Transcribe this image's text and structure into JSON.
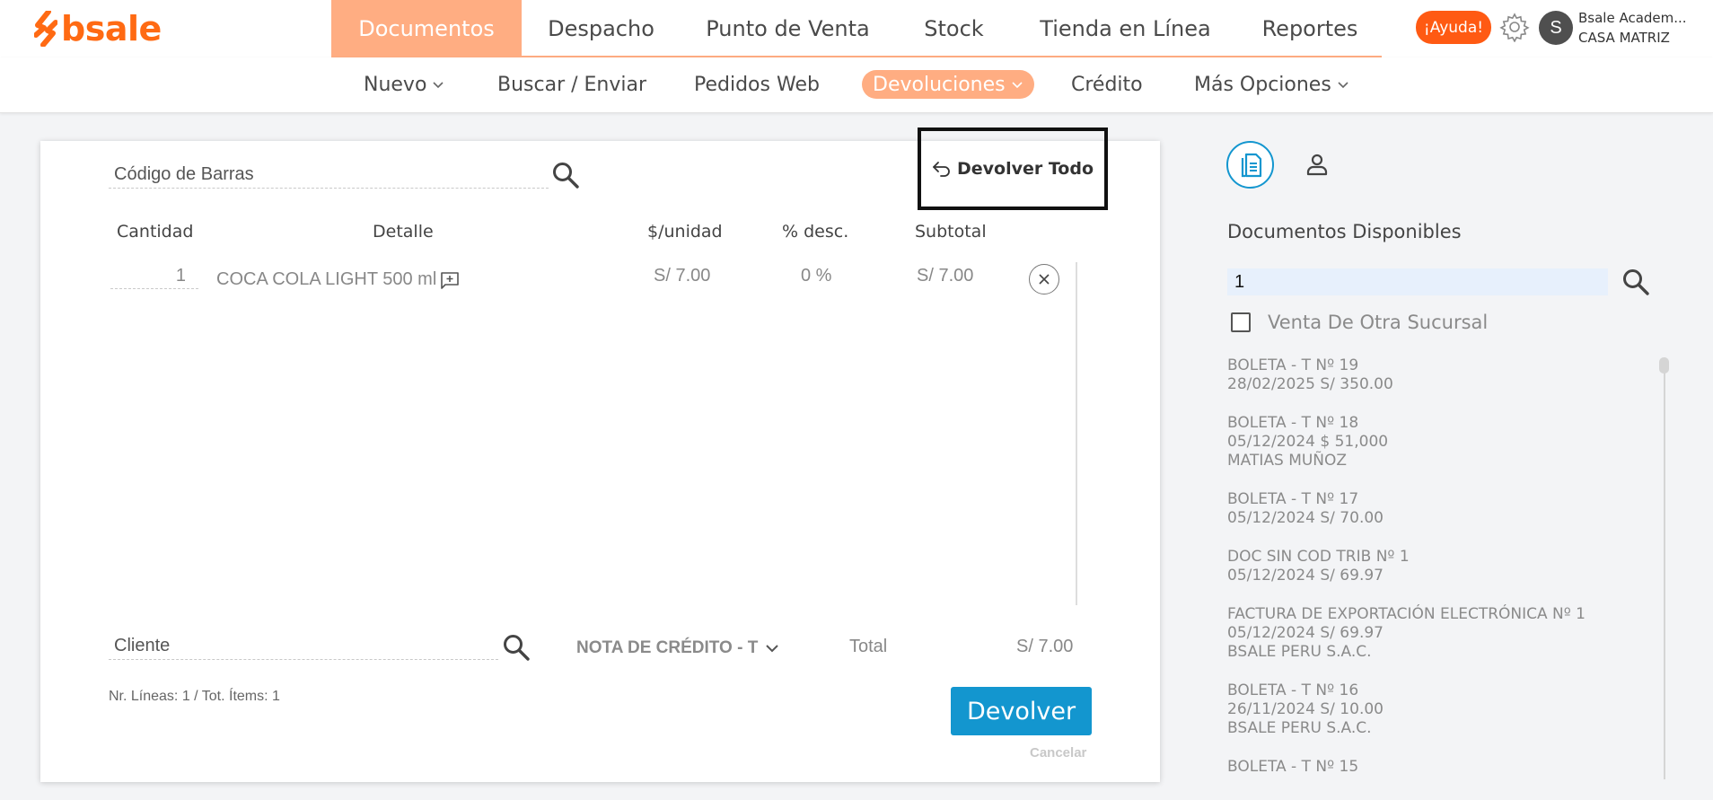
{
  "brand": {
    "logo_text": "bsale",
    "color": "#ff6a13"
  },
  "main_nav": [
    {
      "label": "Documentos",
      "active": true
    },
    {
      "label": "Despacho",
      "active": false
    },
    {
      "label": "Punto de Venta",
      "active": false
    },
    {
      "label": "Stock",
      "active": false
    },
    {
      "label": "Tienda en Línea",
      "active": false
    },
    {
      "label": "Reportes",
      "active": false
    }
  ],
  "header": {
    "help_label": "¡Ayuda!",
    "user_initial": "S",
    "user_name": "Bsale Academ...",
    "branch": "CASA MATRIZ"
  },
  "sub_nav": [
    {
      "label": "Nuevo",
      "dropdown": true
    },
    {
      "label": "Buscar / Enviar",
      "dropdown": false
    },
    {
      "label": "Pedidos Web",
      "dropdown": false
    },
    {
      "label": "Devoluciones",
      "dropdown": true,
      "active": true
    },
    {
      "label": "Crédito",
      "dropdown": false
    },
    {
      "label": "Más Opciones",
      "dropdown": true
    }
  ],
  "return_form": {
    "barcode_placeholder": "Código de Barras",
    "return_all_label": "Devolver Todo",
    "columns": {
      "quantity": "Cantidad",
      "detail": "Detalle",
      "unit_price": "$/unidad",
      "discount": "% desc.",
      "subtotal": "Subtotal"
    },
    "rows": [
      {
        "quantity": "1",
        "detail": "COCA COLA LIGHT 500 ml",
        "unit_price": "S/ 7.00",
        "discount": "0 %",
        "subtotal": "S/ 7.00"
      }
    ],
    "client_placeholder": "Cliente",
    "document_type": "NOTA DE CRÉDITO - T",
    "total_label": "Total",
    "total_value": "S/ 7.00",
    "lines_info": "Nr. Líneas: 1 / Tot. Ítems: 1",
    "submit_label": "Devolver",
    "cancel_label": "Cancelar"
  },
  "side_panel": {
    "title": "Documentos Disponibles",
    "search_value": "1",
    "other_branch_label": "Venta De Otra Sucursal",
    "other_branch_checked": false,
    "documents": [
      {
        "title": "BOLETA - T Nº 19",
        "details": "28/02/2025 S/ 350.00",
        "client": ""
      },
      {
        "title": "BOLETA - T Nº 18",
        "details": "05/12/2024 $ 51,000",
        "client": "MATIAS MUÑOZ"
      },
      {
        "title": "BOLETA - T Nº 17",
        "details": "05/12/2024 S/ 70.00",
        "client": ""
      },
      {
        "title": "DOC SIN COD TRIB Nº 1",
        "details": "05/12/2024 S/ 69.97",
        "client": ""
      },
      {
        "title": "FACTURA DE EXPORTACIÓN ELECTRÓNICA Nº 1",
        "details": "05/12/2024 S/ 69.97",
        "client": "BSALE PERU S.A.C."
      },
      {
        "title": "BOLETA - T Nº 16",
        "details": "26/11/2024 S/ 10.00",
        "client": "BSALE PERU S.A.C."
      },
      {
        "title": "BOLETA - T Nº 15",
        "details": "",
        "client": ""
      }
    ]
  },
  "colors": {
    "nav_active": "#ffad82",
    "help_button": "#ff5a13",
    "primary_button": "#1396cf",
    "search_highlight": "#e7f0fc"
  },
  "icons": {
    "logo": "bsale-logo-icon",
    "settings": "gear-icon",
    "search": "search-icon",
    "return_all": "return-arrow-icon",
    "add_note": "add-comment-icon",
    "remove": "close-icon",
    "dropdown": "chevron-down-icon",
    "documents_tab": "document-icon",
    "client_tab": "user-icon"
  }
}
